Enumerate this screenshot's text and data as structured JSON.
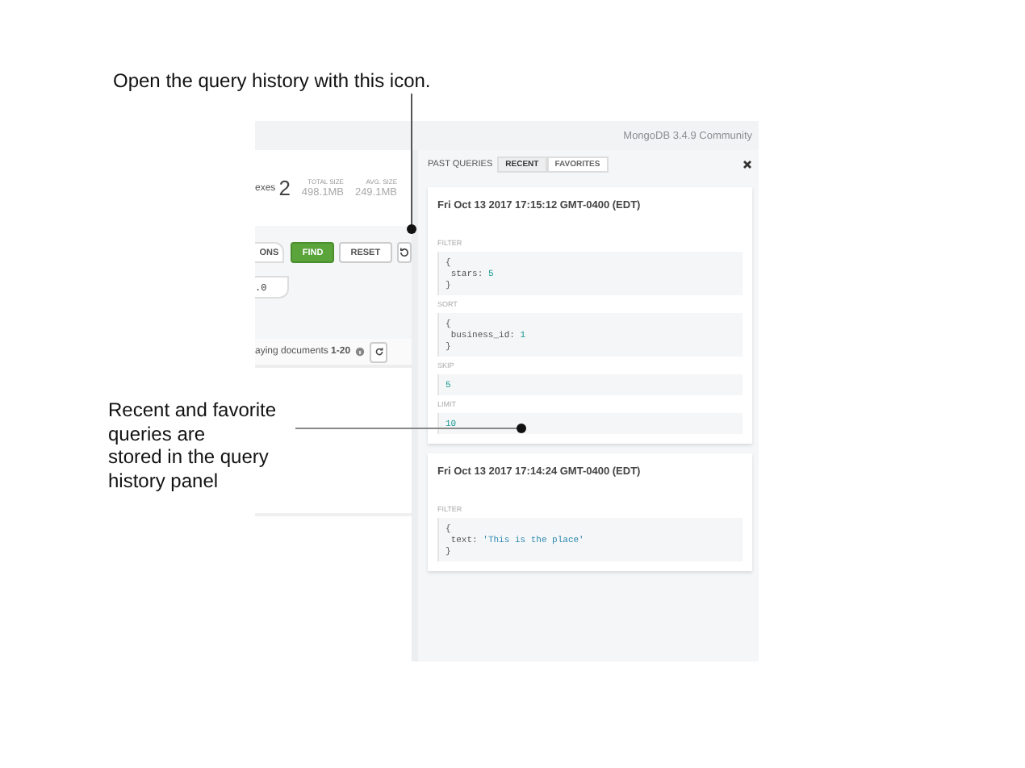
{
  "annotations": [
    {
      "kind": "top",
      "lines": [
        "Open the query history with this icon."
      ]
    },
    {
      "kind": "side",
      "lines": [
        "Recent and favorite",
        "queries are",
        "stored in the query",
        "history panel"
      ]
    }
  ],
  "top_bar": {
    "version": "MongoDB 3.4.9 Community"
  },
  "stats": {
    "indexes_label": "exes",
    "indexes_value": "2",
    "sizes": [
      {
        "label": "TOTAL SIZE",
        "value": "498.1MB"
      },
      {
        "label": "AVG. SIZE",
        "value": "249.1MB"
      }
    ]
  },
  "query_bar": {
    "options_button": "ONS",
    "buttons": [
      {
        "label": "FIND",
        "kind": "primary"
      },
      {
        "label": "RESET",
        "kind": "plain"
      }
    ],
    "field_value": ".0"
  },
  "results": {
    "label": "aying documents",
    "range": "1-20"
  },
  "history_panel": {
    "title": "PAST QUERIES",
    "tabs": [
      {
        "label": "RECENT",
        "selected": true
      },
      {
        "label": "FAVORITES",
        "selected": false
      }
    ],
    "queries": [
      {
        "timestamp": "Fri Oct 13 2017 17:15:12 GMT-0400 (EDT)",
        "fields": [
          {
            "label": "FILTER",
            "kind": "object",
            "key": "stars:",
            "value": "5",
            "open": "{",
            "close": "}"
          },
          {
            "label": "SORT",
            "kind": "object",
            "key": "business_id:",
            "value": "1",
            "open": "{",
            "close": "}"
          },
          {
            "label": "SKIP",
            "kind": "scalar",
            "value": "5"
          },
          {
            "label": "LIMIT",
            "kind": "scalar",
            "value": "10"
          }
        ]
      },
      {
        "timestamp": "Fri Oct 13 2017 17:14:24 GMT-0400 (EDT)",
        "fields": [
          {
            "label": "FILTER",
            "kind": "object",
            "key": "text:",
            "value": "'This is the place'",
            "open": "{",
            "close": "}",
            "string": true
          }
        ]
      }
    ]
  }
}
